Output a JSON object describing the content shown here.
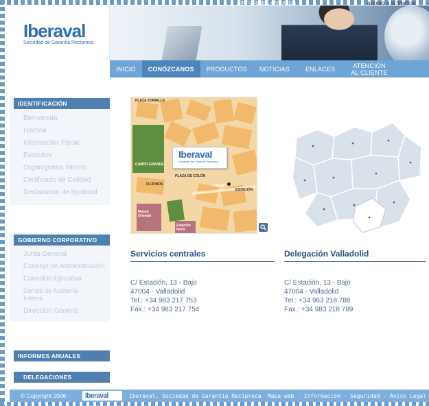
{
  "top_bar": {
    "reports_label": "INFORMES ANUALES",
    "access_text": "acceso a la financia"
  },
  "header": {
    "logo_word": "Iberaval",
    "logo_subtitle": "Sociedad de Garantía Recíproca"
  },
  "nav": {
    "items": [
      {
        "label": "INICIO"
      },
      {
        "label": "CONÓZCANOS"
      },
      {
        "label": "PRODUCTOS"
      },
      {
        "label": "NOTICIAS"
      },
      {
        "label": "ENLACES"
      },
      {
        "label_line1": "ATENCIÓN",
        "label_line2": "AL CLIENTE"
      }
    ],
    "active_index": 1
  },
  "sidebar": {
    "identificacion": {
      "title": "IDENTIFICACIÓN",
      "items": [
        "Bienvenida",
        "Historia",
        "Información Fiscal",
        "Estatutos",
        "Organigrama Interno",
        "Certificado de Calidad",
        "Declaración de Igualdad"
      ]
    },
    "gobierno": {
      "title": "GOBIERNO CORPORATIVO",
      "items": [
        "Junta General",
        "Consejo de Administración",
        "Comisión Ejecutiva",
        "Comité de Auditoría Interna",
        "Dirección General"
      ]
    },
    "informes": {
      "title": "INFORMES ANUALES"
    },
    "delegaciones": {
      "title": "DELEGACIONES"
    }
  },
  "map": {
    "card_word": "Iberaval",
    "card_sub": "Sociedad de Garantía Recíproca",
    "labels": [
      "PLAZA ZORRILLA",
      "CAMPO GRANDE",
      "PLAZA DE COLÓN",
      "ESTACIÓN",
      "FILIPINOS",
      "Museo Oriental",
      "Estación Norte",
      "CALLE"
    ]
  },
  "offices": [
    {
      "title": "Servicios centrales",
      "address": "C/ Estación, 13 - Bajo",
      "city": "47004 - Valladolid",
      "tel": "Tel.: +34 983 217 753",
      "fax": "Fax.: +34 983 217 754"
    },
    {
      "title": "Delegación Valladolid",
      "address": "C/ Estación, 13 - Bajo",
      "city": "47004 - Valladolid",
      "tel": "Tel.: +34 983 218 788",
      "fax": "Fax.: +34 983 218 789"
    }
  ],
  "footer": {
    "copyright": "© Copyright 2006 -",
    "logo_word": "Iberaval",
    "company": "Iberaval, Sociedad de Garantía Recíproca",
    "links": "Mapa web - Información - Seguridad - Aviso Legal"
  },
  "colors": {
    "nav_bg": "#6fa4d6",
    "nav_active": "#4c84bb",
    "section_title_bg": "#4f7fae",
    "brand_blue": "#2c6fb5",
    "footer_bg": "#7eaedc"
  }
}
